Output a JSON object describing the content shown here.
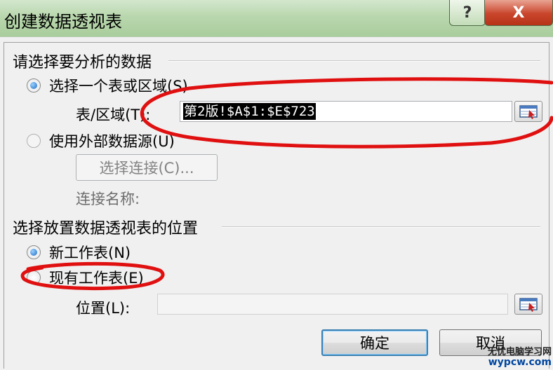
{
  "window": {
    "title": "创建数据透视表",
    "help_label": "?",
    "close_label": "X"
  },
  "analyze_section": {
    "title": "请选择要分析的数据",
    "option_table": "选择一个表或区域(S)",
    "table_range_label": "表/区域(T):",
    "table_range_value": "第2版!$A$1:$E$723",
    "option_external": "使用外部数据源(U)",
    "choose_connection_label": "选择连接(C)...",
    "connection_name_label": "连接名称:"
  },
  "placement_section": {
    "title": "选择放置数据透视表的位置",
    "option_new_sheet": "新工作表(N)",
    "option_existing_sheet": "现有工作表(E)",
    "location_label": "位置(L):",
    "location_value": ""
  },
  "buttons": {
    "ok_label": "确定",
    "cancel_label": "取消"
  },
  "watermark": {
    "line1": "无忧电脑学习网",
    "line2": "wypcw.com"
  },
  "colors": {
    "annotation": "#e01010",
    "title_bar": "#b9d7ae",
    "close_button": "#c9452b"
  },
  "icons": [
    "range-select-icon",
    "close-icon",
    "help-icon"
  ]
}
